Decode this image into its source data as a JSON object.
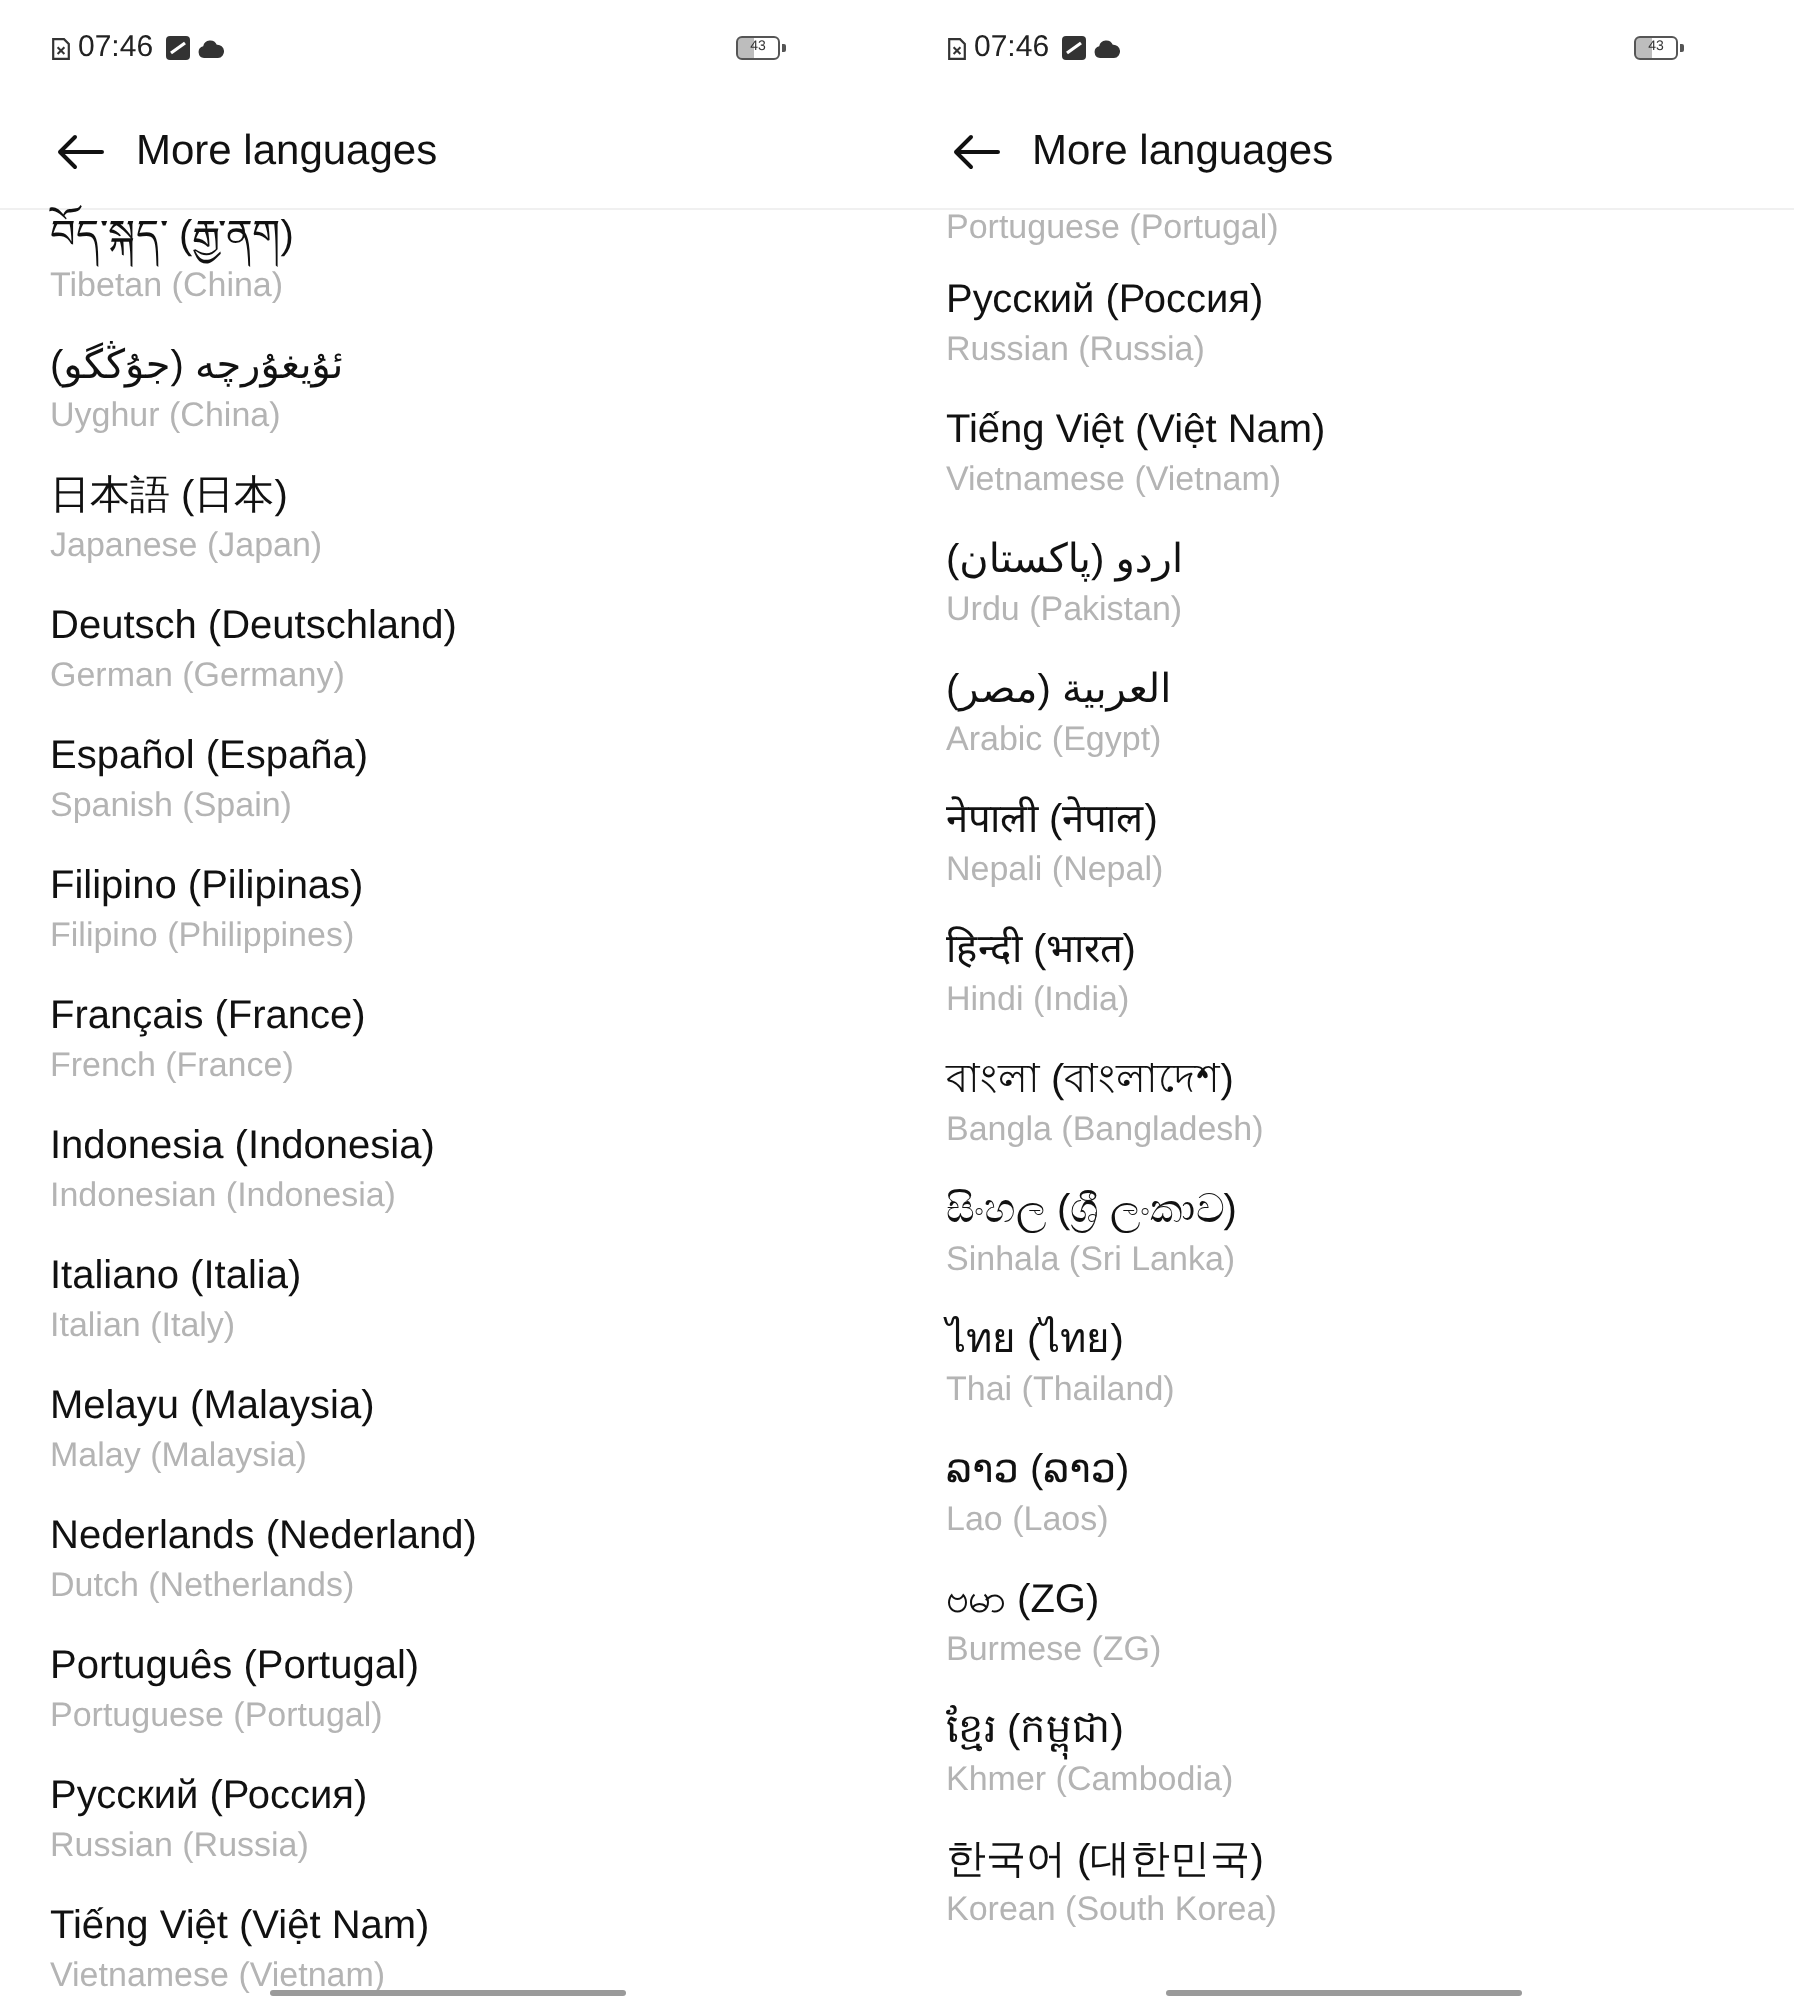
{
  "screens": [
    {
      "status_bar": {
        "time": "07:46",
        "battery": "43"
      },
      "header": {
        "title": "More languages"
      },
      "languages": [
        {
          "native": "བོད་སྐད་ (རྒྱ་ནག)",
          "english": "Tibetan (China)"
        },
        {
          "native": "ئۇيغۇرچە (جۇڭگو)",
          "english": "Uyghur (China)"
        },
        {
          "native": "日本語 (日本)",
          "english": "Japanese (Japan)"
        },
        {
          "native": "Deutsch (Deutschland)",
          "english": "German (Germany)"
        },
        {
          "native": "Español (España)",
          "english": "Spanish (Spain)"
        },
        {
          "native": "Filipino (Pilipinas)",
          "english": "Filipino (Philippines)"
        },
        {
          "native": "Français (France)",
          "english": "French (France)"
        },
        {
          "native": "Indonesia (Indonesia)",
          "english": "Indonesian (Indonesia)"
        },
        {
          "native": "Italiano (Italia)",
          "english": "Italian (Italy)"
        },
        {
          "native": "Melayu (Malaysia)",
          "english": "Malay (Malaysia)"
        },
        {
          "native": "Nederlands (Nederland)",
          "english": "Dutch (Netherlands)"
        },
        {
          "native": "Português (Portugal)",
          "english": "Portuguese (Portugal)"
        },
        {
          "native": "Русский (Россия)",
          "english": "Russian (Russia)"
        },
        {
          "native": "Tiếng Việt (Việt Nam)",
          "english": "Vietnamese (Vietnam)"
        }
      ]
    },
    {
      "status_bar": {
        "time": "07:46",
        "battery": "43"
      },
      "header": {
        "title": "More languages"
      },
      "languages": [
        {
          "english": "Portuguese (Portugal)"
        },
        {
          "native": "Русский (Россия)",
          "english": "Russian (Russia)"
        },
        {
          "native": "Tiếng Việt (Việt Nam)",
          "english": "Vietnamese (Vietnam)"
        },
        {
          "native": "اردو (پاکستان)",
          "english": "Urdu (Pakistan)"
        },
        {
          "native": "العربية (مصر)",
          "english": "Arabic (Egypt)"
        },
        {
          "native": "नेपाली (नेपाल)",
          "english": "Nepali (Nepal)"
        },
        {
          "native": "हिन्दी (भारत)",
          "english": "Hindi (India)"
        },
        {
          "native": "বাংলা (বাংলাদেশ)",
          "english": "Bangla (Bangladesh)"
        },
        {
          "native": "සිංහල (ශ්‍රී ලංකාව)",
          "english": "Sinhala (Sri Lanka)"
        },
        {
          "native": "ไทย (ไทย)",
          "english": "Thai (Thailand)"
        },
        {
          "native": "ລາວ (ລາວ)",
          "english": "Lao (Laos)"
        },
        {
          "native": "ဗမာ (ZG)",
          "english": "Burmese (ZG)"
        },
        {
          "native": "ខ្មែរ (កម្ពុជា)",
          "english": "Khmer (Cambodia)"
        },
        {
          "native": "한국어 (대한민국)",
          "english": "Korean (South Korea)"
        }
      ]
    }
  ]
}
